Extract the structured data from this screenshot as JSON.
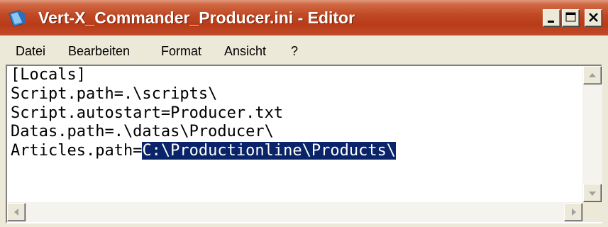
{
  "window": {
    "title": "Vert-X_Commander_Producer.ini - Editor",
    "title_bar_color": "#c14a26",
    "app_icon": "notepad-icon"
  },
  "controls": {
    "minimize_icon": "minimize-icon",
    "maximize_icon": "maximize-icon",
    "close_icon": "close-icon"
  },
  "menu": {
    "items": [
      {
        "label": "Datei"
      },
      {
        "label": "Bearbeiten"
      },
      {
        "label": "Format"
      },
      {
        "label": "Ansicht"
      },
      {
        "label": "?"
      }
    ]
  },
  "editor": {
    "lines": [
      {
        "text": "[Locals]"
      },
      {
        "text": "Script.path=.\\scripts\\"
      },
      {
        "text": "Script.autostart=Producer.txt"
      },
      {
        "text": "Datas.path=.\\datas\\Producer\\"
      },
      {
        "text": "Articles.path=",
        "selected": "C:\\Productionline\\Products\\"
      }
    ],
    "selection_color": "#0a246a"
  },
  "scrollbars": {
    "up_icon": "arrow-up-icon",
    "down_icon": "arrow-down-icon",
    "left_icon": "arrow-left-icon",
    "right_icon": "arrow-right-icon"
  }
}
